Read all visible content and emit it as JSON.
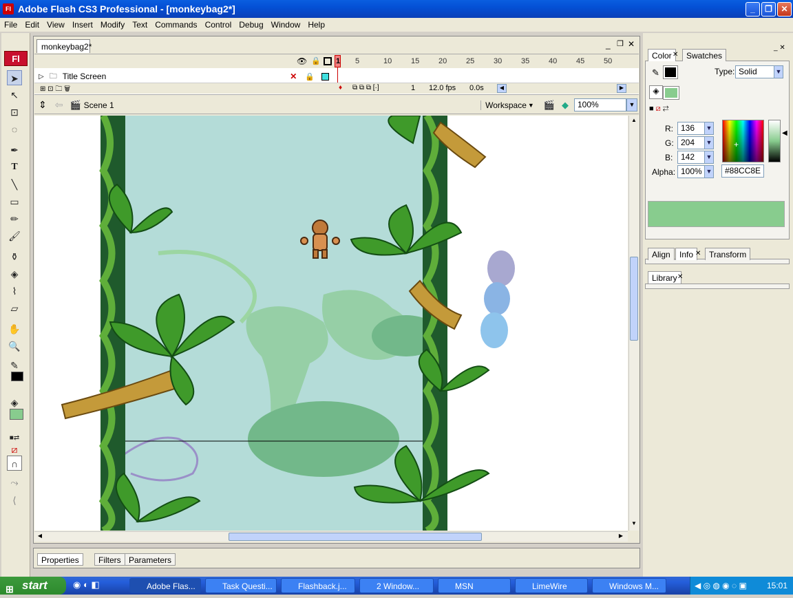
{
  "window": {
    "title": "Adobe Flash CS3 Professional - [monkeybag2*]",
    "app_badge": "Fl"
  },
  "menu": [
    "File",
    "Edit",
    "View",
    "Insert",
    "Modify",
    "Text",
    "Commands",
    "Control",
    "Debug",
    "Window",
    "Help"
  ],
  "document": {
    "tab": "monkeybag2*",
    "layer_name": "Title Screen",
    "frame_numbers": [
      "1",
      "5",
      "10",
      "15",
      "20",
      "25",
      "30",
      "35",
      "40",
      "45",
      "50"
    ],
    "current_frame": "1",
    "fps": "12.0 fps",
    "elapsed": "0.0s",
    "scene": "Scene 1",
    "workspace": "Workspace",
    "zoom": "100%"
  },
  "properties_tabs": [
    "Properties",
    "Filters",
    "Parameters"
  ],
  "color_panel": {
    "tabs": [
      "Color",
      "Swatches"
    ],
    "type_label": "Type:",
    "type_value": "Solid",
    "r_label": "R:",
    "r": "136",
    "g_label": "G:",
    "g": "204",
    "b_label": "B:",
    "b": "142",
    "alpha_label": "Alpha:",
    "alpha": "100%",
    "hex": "#88CC8E",
    "fill_color": "#88cc8e"
  },
  "panel_groups": {
    "align_tabs": [
      "Align",
      "Info",
      "Transform"
    ],
    "library": "Library"
  },
  "taskbar": {
    "start": "start",
    "tasks": [
      "Adobe Flas...",
      "Task Questi...",
      "Flashback.j...",
      "2 Window...",
      "MSN",
      "LimeWire",
      "Windows M..."
    ],
    "clock": "15:01"
  }
}
